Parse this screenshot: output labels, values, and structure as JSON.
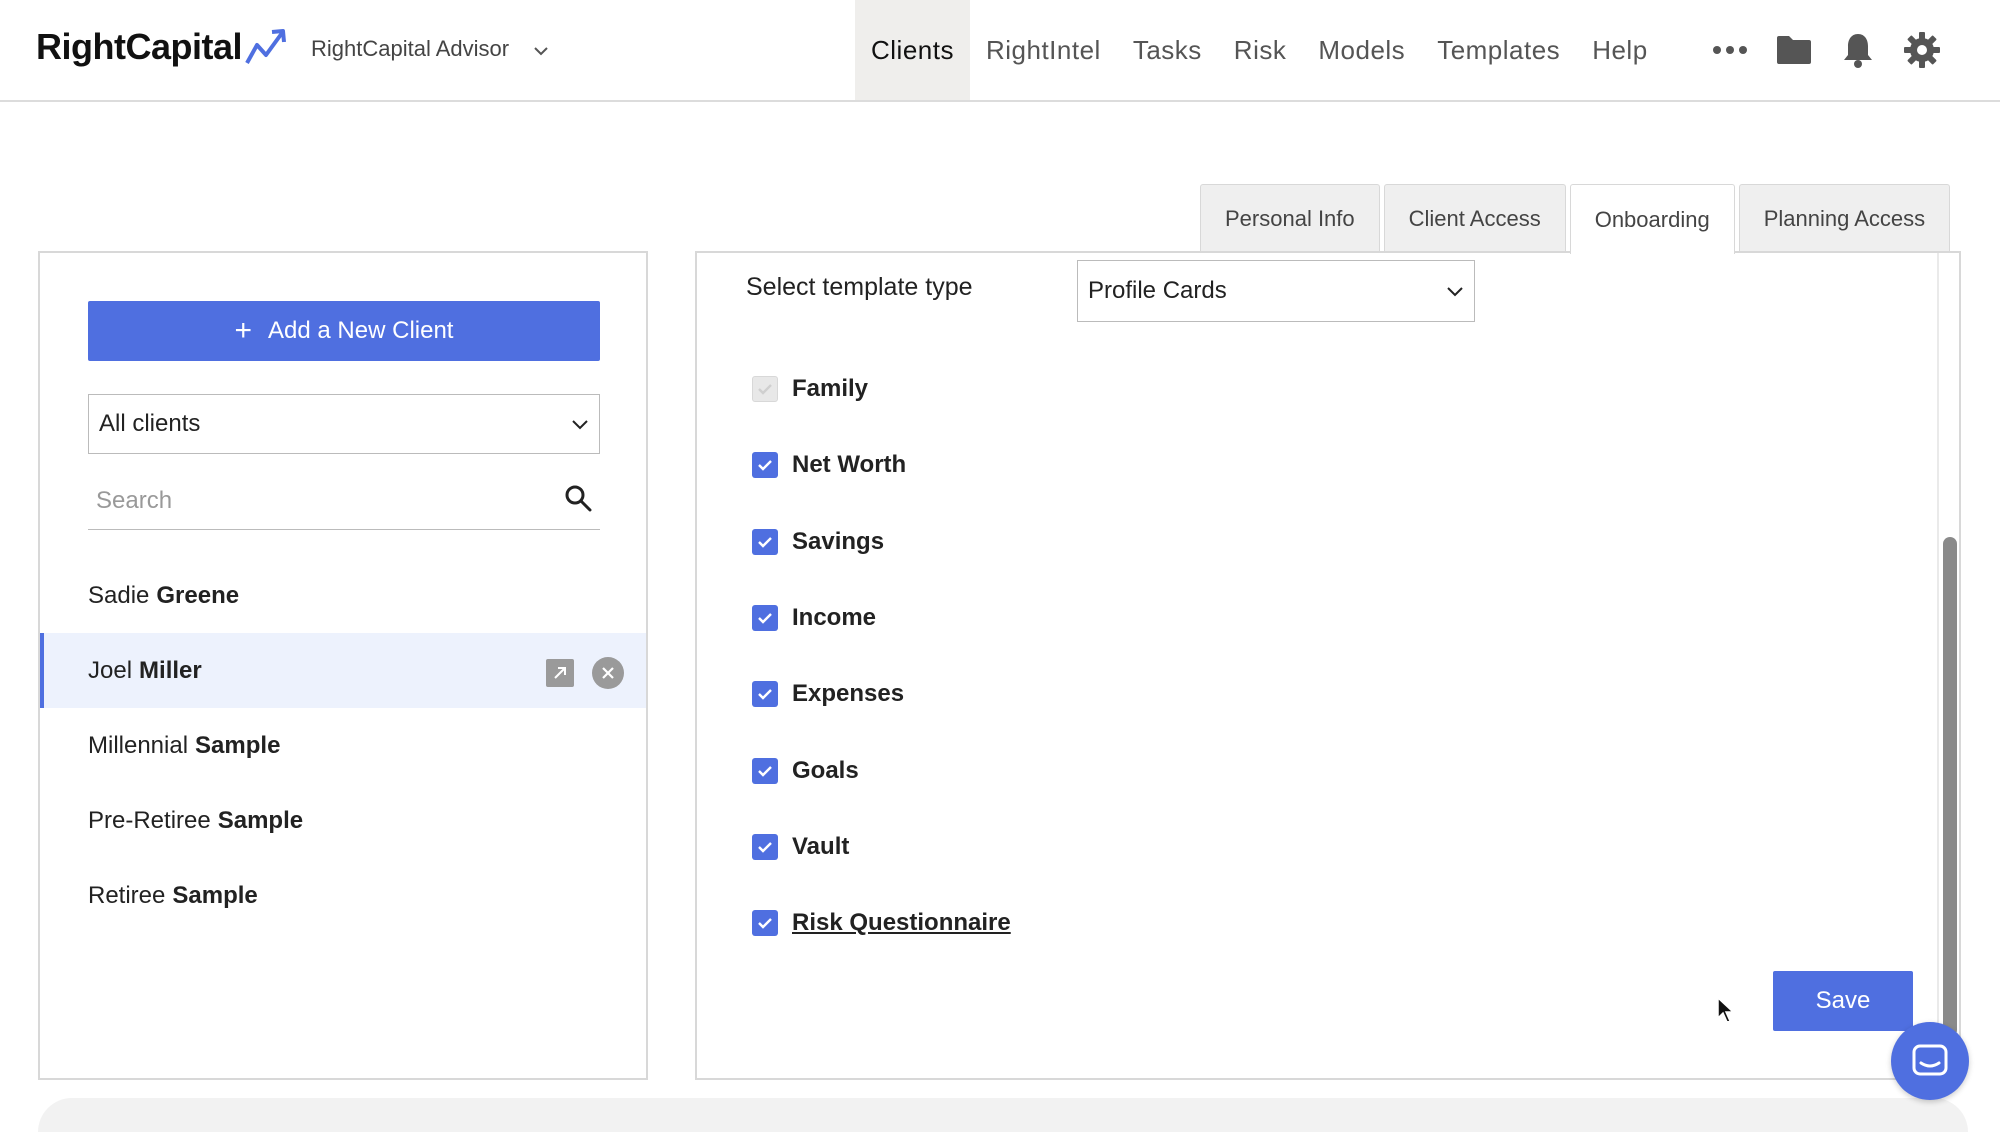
{
  "header": {
    "logo": "RightCapital",
    "advisor": "RightCapital Advisor",
    "nav": [
      "Clients",
      "RightIntel",
      "Tasks",
      "Risk",
      "Models",
      "Templates",
      "Help"
    ],
    "active_nav": "Clients",
    "icons": [
      "more-icon",
      "folder-icon",
      "bell-icon",
      "gear-icon"
    ]
  },
  "tabs": [
    "Personal Info",
    "Client Access",
    "Onboarding",
    "Planning Access"
  ],
  "active_tab": "Onboarding",
  "sidebar": {
    "add_button": "Add a New Client",
    "filter_value": "All clients",
    "search_placeholder": "Search",
    "clients": [
      {
        "first": "Sadie",
        "last": "Greene"
      },
      {
        "first": "Joel",
        "last": "Miller"
      },
      {
        "first": "Millennial",
        "last": "Sample"
      },
      {
        "first": "Pre-Retiree",
        "last": "Sample"
      },
      {
        "first": "Retiree",
        "last": "Sample"
      }
    ],
    "selected_client": "Joel Miller"
  },
  "onboarding": {
    "template_label": "Select template type",
    "template_value": "Profile Cards",
    "cards": [
      {
        "label": "Family",
        "checked": true,
        "disabled": true
      },
      {
        "label": "Net Worth",
        "checked": true
      },
      {
        "label": "Savings",
        "checked": true
      },
      {
        "label": "Income",
        "checked": true
      },
      {
        "label": "Expenses",
        "checked": true
      },
      {
        "label": "Goals",
        "checked": true
      },
      {
        "label": "Vault",
        "checked": true
      },
      {
        "label": "Risk Questionnaire",
        "checked": true,
        "link": true
      }
    ],
    "save_label": "Save"
  },
  "colors": {
    "accent": "#4f6fe0",
    "selected_row": "#edf2fd"
  }
}
